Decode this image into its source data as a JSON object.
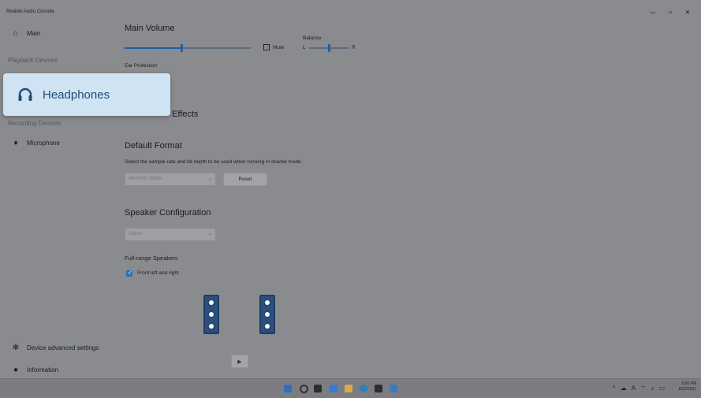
{
  "window": {
    "title": "Realtek Audio Console",
    "controls": {
      "minimize": "–",
      "maximize": "▫",
      "close": "×"
    }
  },
  "sidebar": {
    "main": "Main",
    "playback_header": "Playback Devices",
    "headphones": "Headphones",
    "recording_header": "Recording Devices",
    "microphone": "Microphone",
    "device_advanced": "Device advanced settings",
    "information": "Information"
  },
  "main_volume": {
    "title": "Main Volume",
    "level": 0.45,
    "mute_label": "Mute",
    "balance_label": "Balance",
    "balance_left": "L",
    "balance_right": "R",
    "ear_protection": "Ear Protection"
  },
  "effects": {
    "title": "Effects"
  },
  "default_format": {
    "title": "Default Format",
    "description": "Select the sample rate and bit depth to be used when running in shared mode.",
    "selected": "48000Hz 16Bits",
    "reset": "Reset"
  },
  "speaker_config": {
    "title": "Speaker Configuration",
    "selected": "Stereo",
    "full_range_title": "Full-range Speakers",
    "front_lr": "Front left and right",
    "front_lr_checked": true
  },
  "taskbar": {
    "clock_time": "6:00 PM",
    "clock_date": "8/12/2021"
  }
}
